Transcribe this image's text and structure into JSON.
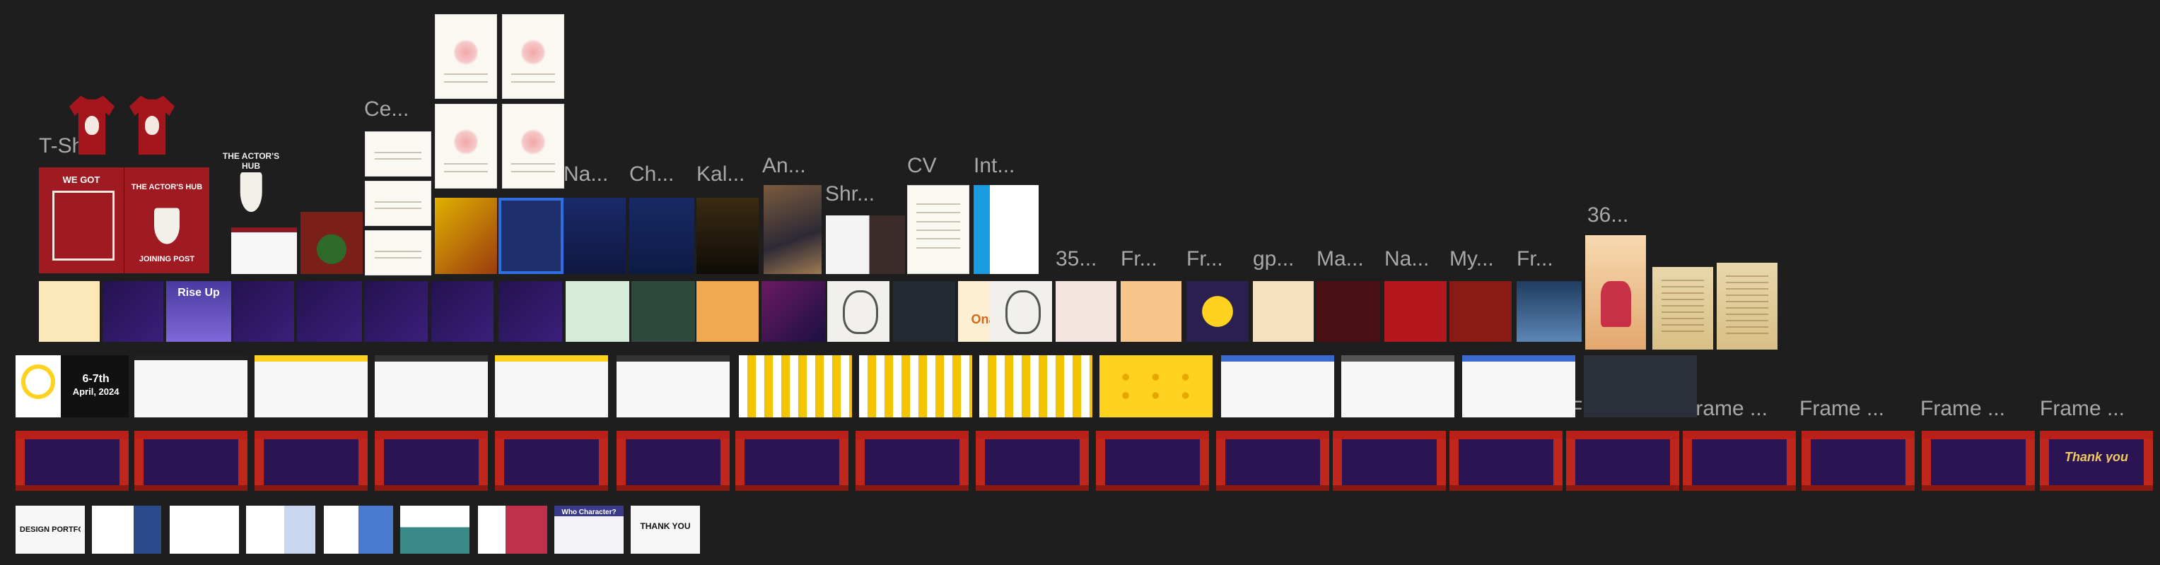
{
  "colors": {
    "canvas": "#1e1e1e",
    "label": "#a8a8a8"
  },
  "labels": {
    "tshirt": "T-Shirt",
    "ce": "Ce...",
    "na1": "Na...",
    "ch": "Ch...",
    "kal": "Kal...",
    "an": "An...",
    "shr": "Shr...",
    "cv": "CV",
    "int": "Int...",
    "n36": "36...",
    "n35": "35...",
    "fr1": "Fr...",
    "fr2": "Fr...",
    "gp": "gp...",
    "ma": "Ma...",
    "na2": "Na...",
    "my": "My...",
    "fr3": "Fr...",
    "frame_a": "Frame ...",
    "frame_b": "Frame ...",
    "frame_c": "Frame ...",
    "frame_d": "Frame ...",
    "frame_e": "Frame ..."
  },
  "frames": {
    "post_title": "THE ACTOR'S HUB",
    "post_sub": "JOINING POST",
    "we_got": "WE GOT",
    "rise_up": "Rise Up",
    "onam": "Onam",
    "date_line1": "6-7th",
    "date_line2": "April, 2024",
    "thank_you": "Thank you",
    "thank": "THANK YOU",
    "portfolio": "DESIGN PORTFOLIO",
    "who": "Who Character?"
  }
}
